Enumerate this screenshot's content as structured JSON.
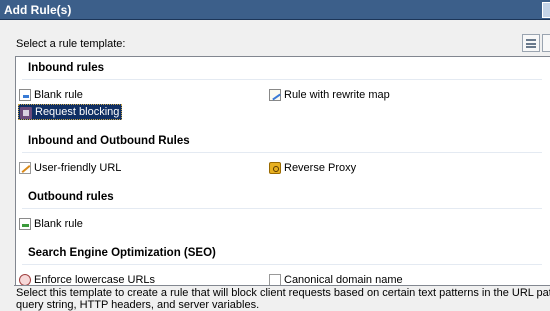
{
  "window": {
    "title": "Add Rule(s)"
  },
  "prompt": "Select a rule template:",
  "groups": [
    {
      "title": "Inbound rules",
      "items": [
        {
          "label": "Blank rule",
          "icon": "blank-rule-icon"
        },
        {
          "label": "Rule with rewrite map",
          "icon": "rewrite-map-icon"
        },
        {
          "label": "Request blocking",
          "icon": "request-blocking-icon",
          "selected": true
        }
      ]
    },
    {
      "title": "Inbound and Outbound Rules",
      "items": [
        {
          "label": "User-friendly URL",
          "icon": "user-friendly-url-icon"
        },
        {
          "label": "Reverse Proxy",
          "icon": "reverse-proxy-icon"
        }
      ]
    },
    {
      "title": "Outbound rules",
      "items": [
        {
          "label": "Blank rule",
          "icon": "outbound-blank-rule-icon"
        }
      ]
    },
    {
      "title": "Search Engine Optimization (SEO)",
      "items": [
        {
          "label": "Enforce lowercase URLs",
          "icon": "lowercase-url-icon"
        },
        {
          "label": "Canonical domain name",
          "icon": "canonical-domain-icon"
        }
      ]
    }
  ],
  "description": {
    "line1": "Select this template to create a rule that will block client requests based on certain text patterns in the URL path,",
    "line2": "query string, HTTP headers, and server variables."
  },
  "colors": {
    "title_bar": "#3c5f8a",
    "selection": "#102f63"
  }
}
